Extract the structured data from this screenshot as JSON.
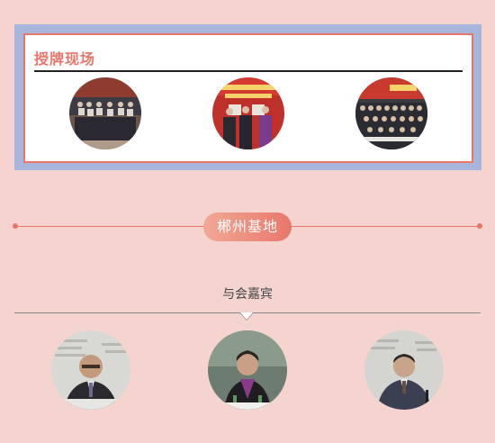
{
  "plaque_section": {
    "title": "授牌现场",
    "photos": [
      "plaque-ceremony-photo-1",
      "plaque-ceremony-photo-2",
      "plaque-ceremony-photo-3"
    ]
  },
  "base": {
    "label": "郴州基地"
  },
  "guests": {
    "label": "与会嘉宾",
    "photos": [
      "guest-photo-1",
      "guest-photo-2",
      "guest-photo-3"
    ]
  },
  "colors": {
    "accent": "#e8776a",
    "panel_border": "#a8b6de",
    "background": "#f5d4d0"
  }
}
